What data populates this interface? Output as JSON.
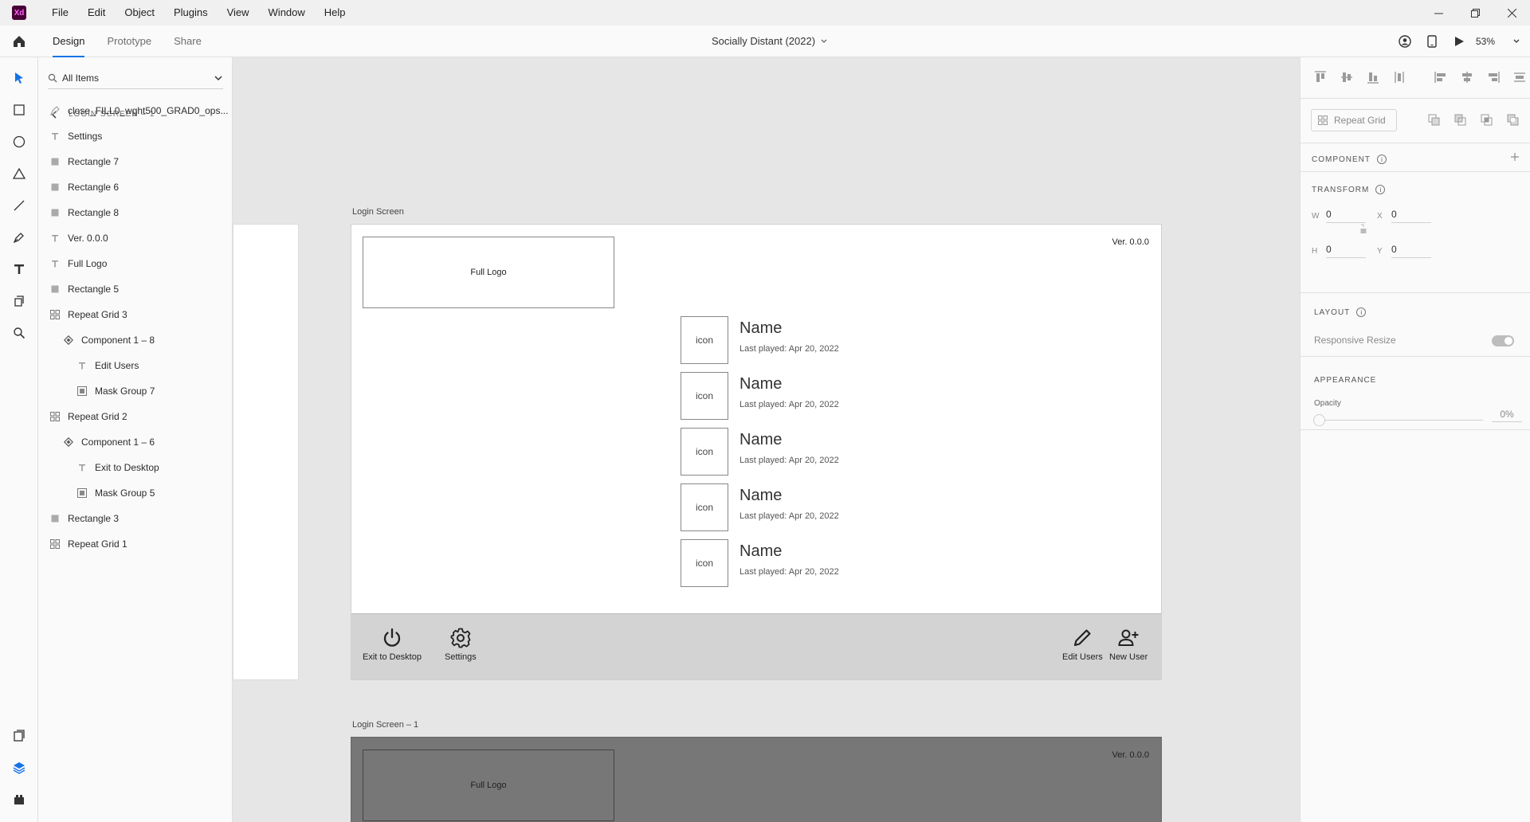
{
  "app": {
    "logo": "Xd",
    "brand_color": "#470137",
    "accent_color": "#1473e6"
  },
  "menu": [
    "File",
    "Edit",
    "Object",
    "Plugins",
    "View",
    "Window",
    "Help"
  ],
  "modes": {
    "tabs": [
      "Design",
      "Prototype",
      "Share"
    ],
    "active": "Design"
  },
  "document": {
    "title": "Socially Distant (2022)"
  },
  "zoom": "53%",
  "layers": {
    "filter": "All Items",
    "breadcrumb": "LOGIN SCREEN – 1",
    "items": [
      {
        "label": "close_FILL0_wght500_GRAD0_ops...",
        "icon": "path-icon",
        "indent": 0
      },
      {
        "label": "Settings",
        "icon": "text-icon",
        "indent": 0
      },
      {
        "label": "Rectangle 7",
        "icon": "rectangle-icon",
        "indent": 0
      },
      {
        "label": "Rectangle 6",
        "icon": "rectangle-icon",
        "indent": 0
      },
      {
        "label": "Rectangle 8",
        "icon": "rectangle-icon",
        "indent": 0
      },
      {
        "label": "Ver. 0.0.0",
        "icon": "text-icon",
        "indent": 0
      },
      {
        "label": "Full Logo",
        "icon": "text-icon",
        "indent": 0
      },
      {
        "label": "Rectangle 5",
        "icon": "rectangle-icon",
        "indent": 0
      },
      {
        "label": "Repeat Grid 3",
        "icon": "repeat-grid-icon",
        "indent": 0
      },
      {
        "label": "Component 1 – 8",
        "icon": "component-icon",
        "indent": 1
      },
      {
        "label": "Edit Users",
        "icon": "text-icon",
        "indent": 2
      },
      {
        "label": "Mask Group 7",
        "icon": "mask-group-icon",
        "indent": 2
      },
      {
        "label": "Repeat Grid 2",
        "icon": "repeat-grid-icon",
        "indent": 0
      },
      {
        "label": "Component 1 – 6",
        "icon": "component-icon",
        "indent": 1
      },
      {
        "label": "Exit to Desktop",
        "icon": "text-icon",
        "indent": 2
      },
      {
        "label": "Mask Group 5",
        "icon": "mask-group-icon",
        "indent": 2
      },
      {
        "label": "Rectangle 3",
        "icon": "rectangle-icon",
        "indent": 0
      },
      {
        "label": "Repeat Grid 1",
        "icon": "repeat-grid-icon",
        "indent": 0
      }
    ]
  },
  "canvas": {
    "artboard1": {
      "label": "Login Screen",
      "logo_text": "Full Logo",
      "version": "Ver. 0.0.0",
      "users": [
        {
          "icon_text": "icon",
          "name": "Name",
          "last": "Last played: Apr 20, 2022"
        },
        {
          "icon_text": "icon",
          "name": "Name",
          "last": "Last played: Apr 20, 2022"
        },
        {
          "icon_text": "icon",
          "name": "Name",
          "last": "Last played: Apr 20, 2022"
        },
        {
          "icon_text": "icon",
          "name": "Name",
          "last": "Last played: Apr 20, 2022"
        },
        {
          "icon_text": "icon",
          "name": "Name",
          "last": "Last played: Apr 20, 2022"
        }
      ],
      "bottom_buttons": {
        "exit": "Exit to Desktop",
        "settings": "Settings",
        "edit_users": "Edit Users",
        "new_user": "New User"
      }
    },
    "artboard2": {
      "label": "Login Screen – 1",
      "logo_text": "Full Logo",
      "version": "Ver. 0.0.0"
    }
  },
  "inspector": {
    "repeat_grid": "Repeat Grid",
    "component": "COMPONENT",
    "transform": "TRANSFORM",
    "w": "0",
    "h": "0",
    "x": "0",
    "y": "0",
    "labels": {
      "w": "W",
      "h": "H",
      "x": "X",
      "y": "Y"
    },
    "layout": "LAYOUT",
    "responsive_resize": "Responsive Resize",
    "appearance": "APPEARANCE",
    "opacity_label": "Opacity",
    "opacity_value": "0%"
  }
}
